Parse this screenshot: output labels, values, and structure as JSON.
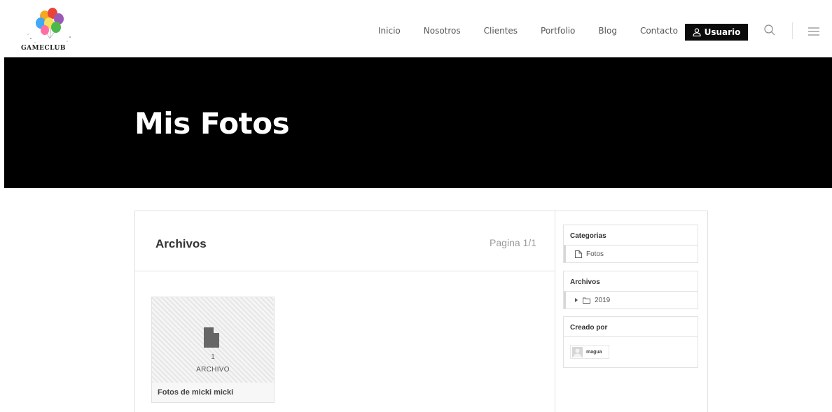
{
  "brand": {
    "logo_text": "GAMECLUB"
  },
  "nav": {
    "items": [
      "Inicio",
      "Nosotros",
      "Clientes",
      "Portfolio",
      "Blog",
      "Contacto"
    ],
    "user_label": "Usuario"
  },
  "icons": {
    "user": "user-icon",
    "search": "search-icon",
    "menu": "hamburger-menu-icon",
    "file": "file-icon",
    "folder": "folder-icon"
  },
  "colors": {
    "hero_bg": "#000000",
    "user_button_bg": "#0b0b0b",
    "balloon_colors": [
      "#e8443a",
      "#f5a623",
      "#f7e15a",
      "#4cb84c",
      "#3fa9f5",
      "#9b59b6",
      "#ff6fa5"
    ]
  },
  "hero": {
    "title": "Mis Fotos"
  },
  "main": {
    "title": "Archivos",
    "page_indicator": "Pagina 1/1",
    "card": {
      "count": "1",
      "count_label": "ARCHIVO",
      "title": "Fotos de micki micki"
    }
  },
  "sidebar": {
    "categories": {
      "title": "Categorias",
      "items": [
        "Fotos"
      ]
    },
    "archives": {
      "title": "Archivos",
      "items": [
        "2019"
      ]
    },
    "author": {
      "title": "Creado por",
      "name": "magua"
    }
  }
}
